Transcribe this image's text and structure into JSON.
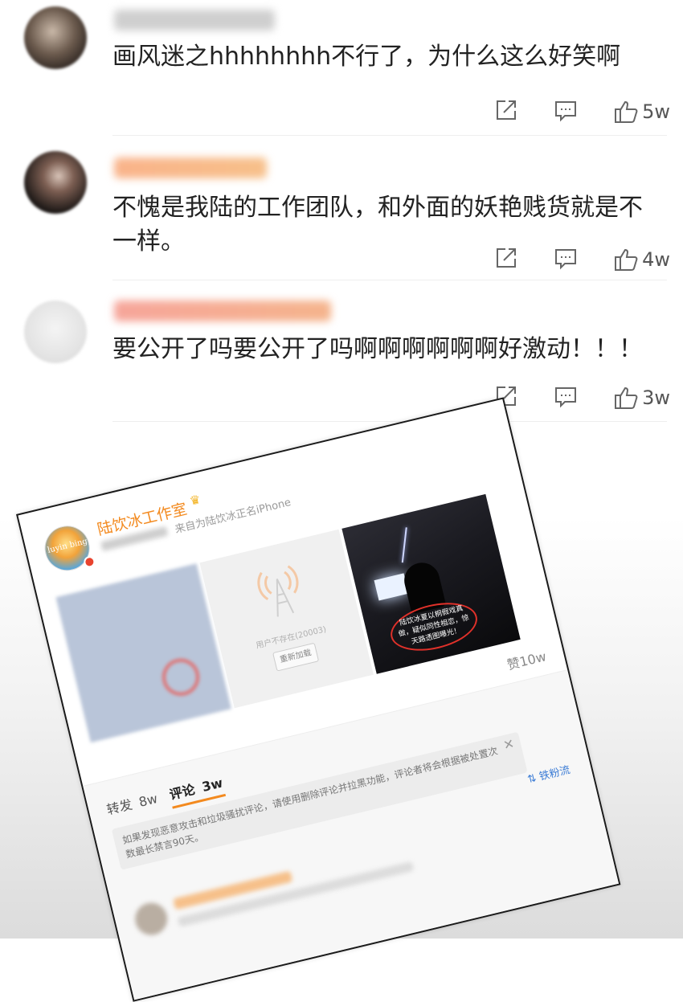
{
  "comments": [
    {
      "text": "画风迷之hhhhhhhh不行了，为什么这么好笑啊",
      "likes": "5w"
    },
    {
      "text": "不愧是我陆的工作团队，和外面的妖艳贱货就是不一样。",
      "likes": "4w"
    },
    {
      "text": "要公开了吗要公开了吗啊啊啊啊啊啊好激动！！！",
      "likes": "3w"
    }
  ],
  "card": {
    "author": "陆饮冰工作室",
    "source": "来自为陆饮冰正名iPhone",
    "avatar_text": "luyin bing",
    "image_error": "用户不存在(20003)",
    "reload_button": "重新加载",
    "photo_caption": "陆饮冰夏以桐假戏真做，疑似同性相恋，惊天路透图曝光！",
    "likes": "赞10w",
    "tabs": [
      {
        "label": "转发",
        "count": "8w"
      },
      {
        "label": "评论",
        "count": "3w"
      }
    ],
    "notice": "如果发现恶意攻击和垃圾骚扰评论，请使用删除评论并拉黑功能，评论者将会根据被处置次数最长禁言90天。",
    "fan_label": "铁粉流"
  },
  "colors": {
    "accent": "#f38a1f",
    "link": "#3a7bd5",
    "text": "#222222"
  }
}
